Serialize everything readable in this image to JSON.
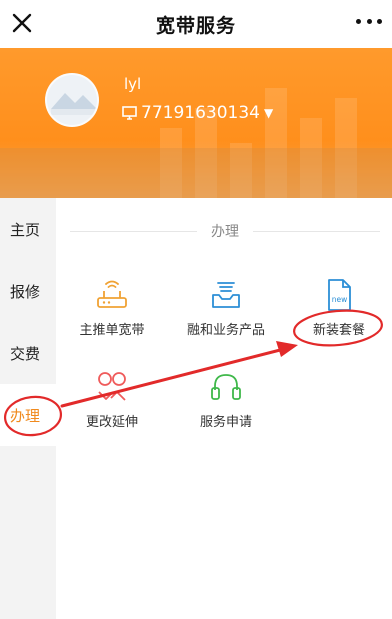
{
  "header": {
    "title": "宽带服务"
  },
  "account": {
    "username": "lyl",
    "phone": "77191630134"
  },
  "sidebar": {
    "items": [
      {
        "label": "主页"
      },
      {
        "label": "报修"
      },
      {
        "label": "交费"
      },
      {
        "label": "办理",
        "active": true
      }
    ]
  },
  "section": {
    "title": "办理"
  },
  "services": [
    {
      "label": "主推单宽带",
      "icon": "router-icon"
    },
    {
      "label": "融和业务产品",
      "icon": "inbox-tray-icon"
    },
    {
      "label": "新装套餐",
      "icon": "new-document-icon",
      "badge": "new"
    },
    {
      "label": "更改延伸",
      "icon": "swap-circles-icon"
    },
    {
      "label": "服务申请",
      "icon": "headset-icon"
    }
  ],
  "colors": {
    "accent": "#f08a1e",
    "banner": "#ff9a2c",
    "annotation": "#e22a2a",
    "icon_blue": "#2c8fd6",
    "icon_green": "#3fb84a"
  }
}
